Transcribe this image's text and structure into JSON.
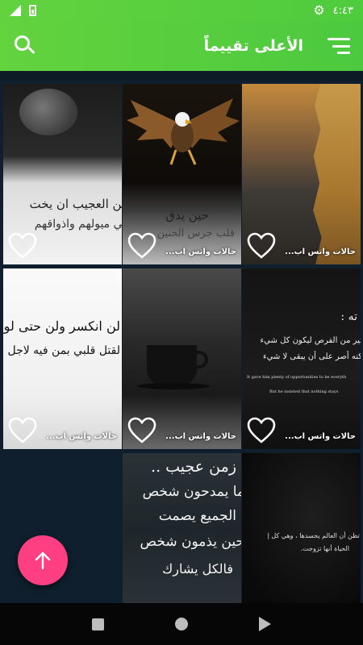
{
  "status_bar": {
    "time": "٤:٤٣"
  },
  "app_bar": {
    "title": "الأعلى تقييماً"
  },
  "cards": [
    {
      "label": "حالات واتس اب..."
    },
    {
      "label": "حالات واتس اب..."
    },
    {
      "label": "حالات واتس اب..."
    },
    {
      "label": "حالات واتس اب..."
    },
    {
      "label": "حالات واتس اب..."
    },
    {
      "label": "حالات واتس اب..."
    }
  ],
  "card_art": {
    "c1_line1": "من العجيب ان يخت",
    "c1_line2": "في ميولهم واذواقهم",
    "c2_line1": "حين يدق",
    "c2_line2": "قلب جرس الحنين",
    "c4_line1": "لن انكسر ولن حتى لو",
    "c4_line2": "لقتل قلبي بمن فيه لاجل",
    "c6_head": "ته :",
    "c6_line1": "ثير من الفرص ليكون كل شيء",
    "c6_line2": "كنه أصر على أن يبقى لا شيء",
    "c6_en1": "It gave him plenty of opportunities to be everyth",
    "c6_en2": "But he insisted that nothing stays",
    "c8_line1": "زمن عجيب ..",
    "c8_line2": "ما يمدحون شخص",
    "c8_line3": "الجميع يصمت",
    "c8_line4": "حين يذمون شخص",
    "c8_line5": "فالكل يشارك",
    "c9_line1": "لا تظن أن العالم يحسدها ، وهي كل إ",
    "c9_line2": "الحياة أنها تزوجت."
  },
  "colors": {
    "app_bar": "#4fcb3e",
    "fab": "#ff3f82",
    "background": "#0f1f2d"
  }
}
